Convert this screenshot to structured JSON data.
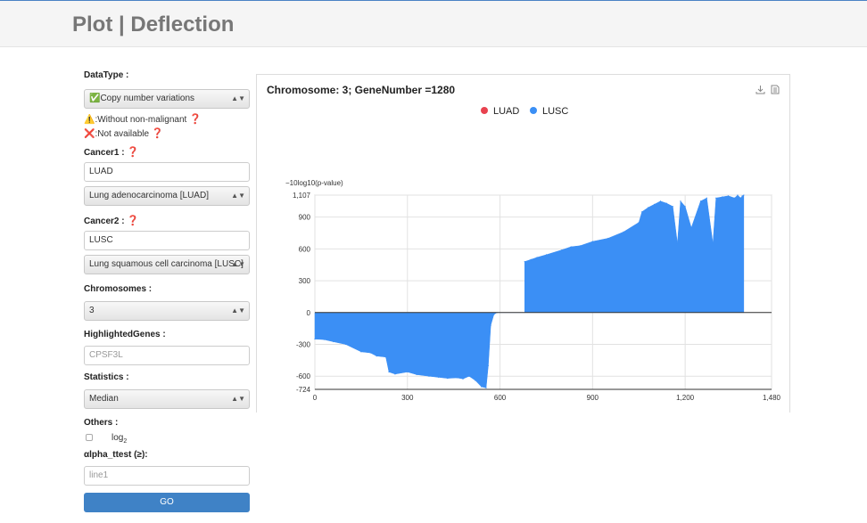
{
  "header": {
    "title": "Plot | Deflection"
  },
  "sidebar": {
    "datatype_label": "DataType :",
    "datatype_value": "✅Copy number variations",
    "note_warning": "⚠️:Without non-malignant",
    "note_unavailable": "❌:Not available",
    "help_mark": "❓",
    "cancer1_label": "Cancer1 :",
    "cancer1_value": "LUAD",
    "cancer1_select": "Lung adenocarcinoma [LUAD]",
    "cancer2_label": "Cancer2 :",
    "cancer2_value": "LUSC",
    "cancer2_select": "Lung squamous cell carcinoma [LUSC]",
    "chromosomes_label": "Chromosomes :",
    "chromosomes_value": "3",
    "highlighted_label": "HighlightedGenes :",
    "highlighted_placeholder": "CPSF3L",
    "statistics_label": "Statistics :",
    "statistics_value": "Median",
    "others_label": "Others :",
    "log_label": "log",
    "log_sub": "2",
    "alpha_label": "αlpha_ttest (≥):",
    "alpha_placeholder": "line1",
    "go_label": "GO",
    "select_arrows": "▲▼"
  },
  "chart_panel": {
    "title": "Chromosome: 3; GeneNumber =1280",
    "download_icon": "download-icon",
    "data_icon": "document-icon"
  },
  "colors": {
    "luad": "#e8424f",
    "lusc": "#3b8ff5",
    "go_button": "#3f82c6"
  },
  "chart_data": {
    "type": "area",
    "title": "",
    "ylabel": "−10log10(p-value)",
    "xlim": [
      0,
      1480
    ],
    "ylim": [
      -724,
      1107
    ],
    "x_ticks": [
      "0",
      "300",
      "600",
      "900",
      "1,200",
      "1,480"
    ],
    "y_ticks": [
      "1,107",
      "900",
      "600",
      "300",
      "0",
      "-300",
      "-600",
      "-724"
    ],
    "grid": true,
    "legend_position": "top-center",
    "series": [
      {
        "name": "LUAD",
        "color": "#e8424f",
        "values": []
      },
      {
        "name": "LUSC",
        "color": "#3b8ff5",
        "x": [
          0,
          30,
          60,
          100,
          150,
          180,
          200,
          230,
          240,
          260,
          300,
          330,
          370,
          400,
          430,
          460,
          480,
          500,
          520,
          540,
          555,
          562,
          570,
          580,
          590,
          680,
          700,
          720,
          750,
          800,
          830,
          860,
          900,
          950,
          1000,
          1050,
          1060,
          1080,
          1100,
          1120,
          1140,
          1160,
          1175,
          1185,
          1200,
          1220,
          1250,
          1270,
          1290,
          1300,
          1320,
          1340,
          1360,
          1370,
          1380,
          1385,
          1390
        ],
        "values": [
          -250,
          -255,
          -275,
          -300,
          -370,
          -380,
          -410,
          -420,
          -560,
          -580,
          -560,
          -585,
          -600,
          -610,
          -620,
          -615,
          -625,
          -600,
          -640,
          -700,
          -710,
          -500,
          -120,
          -20,
          0,
          480,
          500,
          520,
          545,
          590,
          620,
          630,
          670,
          700,
          760,
          850,
          950,
          990,
          1020,
          1050,
          1030,
          1000,
          650,
          1050,
          1000,
          800,
          1050,
          1080,
          650,
          1080,
          1090,
          1100,
          1080,
          1107,
          1080,
          1100,
          1107
        ]
      }
    ]
  }
}
